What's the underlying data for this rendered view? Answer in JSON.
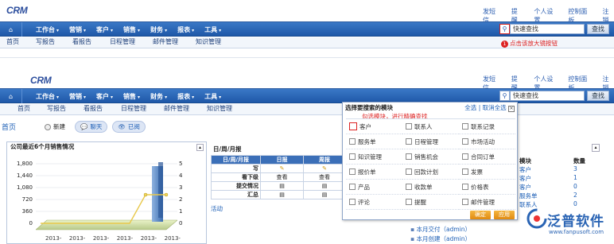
{
  "screen1": {
    "logo": "CRM",
    "top_links": [
      "发短信",
      "提醒",
      "个人设置",
      "控制面板",
      "注销"
    ],
    "menu": [
      "工作台",
      "营销",
      "客户",
      "销售",
      "财务",
      "报表",
      "工具"
    ],
    "search_placeholder": "快速查找",
    "search_button": "查找",
    "subnav": [
      "首页",
      "写报告",
      "看报告",
      "日程管理",
      "邮件管理",
      "知识管理"
    ],
    "annotation": {
      "num": "1",
      "text": "点击该放大镜按钮"
    }
  },
  "screen2": {
    "logo": "CRM",
    "top_links": [
      "发短信",
      "提醒",
      "个人设置",
      "控制面板",
      "注销"
    ],
    "menu": [
      "工作台",
      "营销",
      "客户",
      "销售",
      "财务",
      "报表",
      "工具"
    ],
    "search_value": "快速查找",
    "search_button": "查找",
    "subnav": [
      "首页",
      "写报告",
      "看报告",
      "日程管理",
      "邮件管理",
      "知识管理"
    ],
    "page_title": "首页",
    "tabs": [
      {
        "label": "新建",
        "active": false
      },
      {
        "label": "聊天",
        "active": true
      },
      {
        "label": "已阅",
        "active": true
      }
    ],
    "sales_panel": {
      "title": "公司最近6个月销售情况",
      "left_ticks": [
        "1,800",
        "1,440",
        "1,080",
        "720",
        "360",
        "0"
      ],
      "right_ticks": [
        "5",
        "4",
        "3",
        "2",
        "1",
        "0"
      ],
      "x_labels": [
        "2013-",
        "2013-",
        "2013-",
        "2013-",
        "2013-",
        "2013-"
      ]
    },
    "report_panel": {
      "title": "日/周/月报",
      "headers": [
        "日/周/月报",
        "日报",
        "周报"
      ],
      "rows": [
        {
          "label": "写",
          "c1": "✎",
          "c2": "✎"
        },
        {
          "label": "看下级",
          "c1": "查看",
          "c2": "查看"
        },
        {
          "label": "提交情况",
          "c1": "▤",
          "c2": "▤"
        },
        {
          "label": "汇总",
          "c1": "▤",
          "c2": "▤"
        }
      ],
      "footer_link": "活动"
    },
    "dialog": {
      "title": "选择要搜索的模块",
      "select_all": "全选",
      "sep": "|",
      "clear_all": "取消全选",
      "hint": "勾选模块，进行精确查找",
      "modules": [
        "客户",
        "联系人",
        "联系记录",
        "服务单",
        "日程管理",
        "市场活动",
        "知识管理",
        "销售机会",
        "合同订单",
        "报价单",
        "回款计划",
        "发票",
        "产品",
        "收款单",
        "价格表",
        "评论",
        "提醒",
        "邮件管理"
      ],
      "confirm": "确定",
      "apply": "应用"
    },
    "stats": {
      "headers": [
        "模块",
        "数量"
      ],
      "rows": [
        [
          "客户",
          "3"
        ],
        [
          "客户",
          "1"
        ],
        [
          "客户",
          "0"
        ],
        [
          "服务单",
          "2"
        ],
        [
          "联系人",
          "0"
        ]
      ]
    },
    "news": [
      "本月交付（admin）",
      "本月创建（admin）"
    ],
    "watermark": "泛普软件",
    "watermark_url": "www.fanpusoft.com"
  },
  "colors": {
    "nav": "#2a64b4",
    "accent_red": "#dd2222",
    "link": "#1d5fb6",
    "orange": "#f0a020"
  }
}
